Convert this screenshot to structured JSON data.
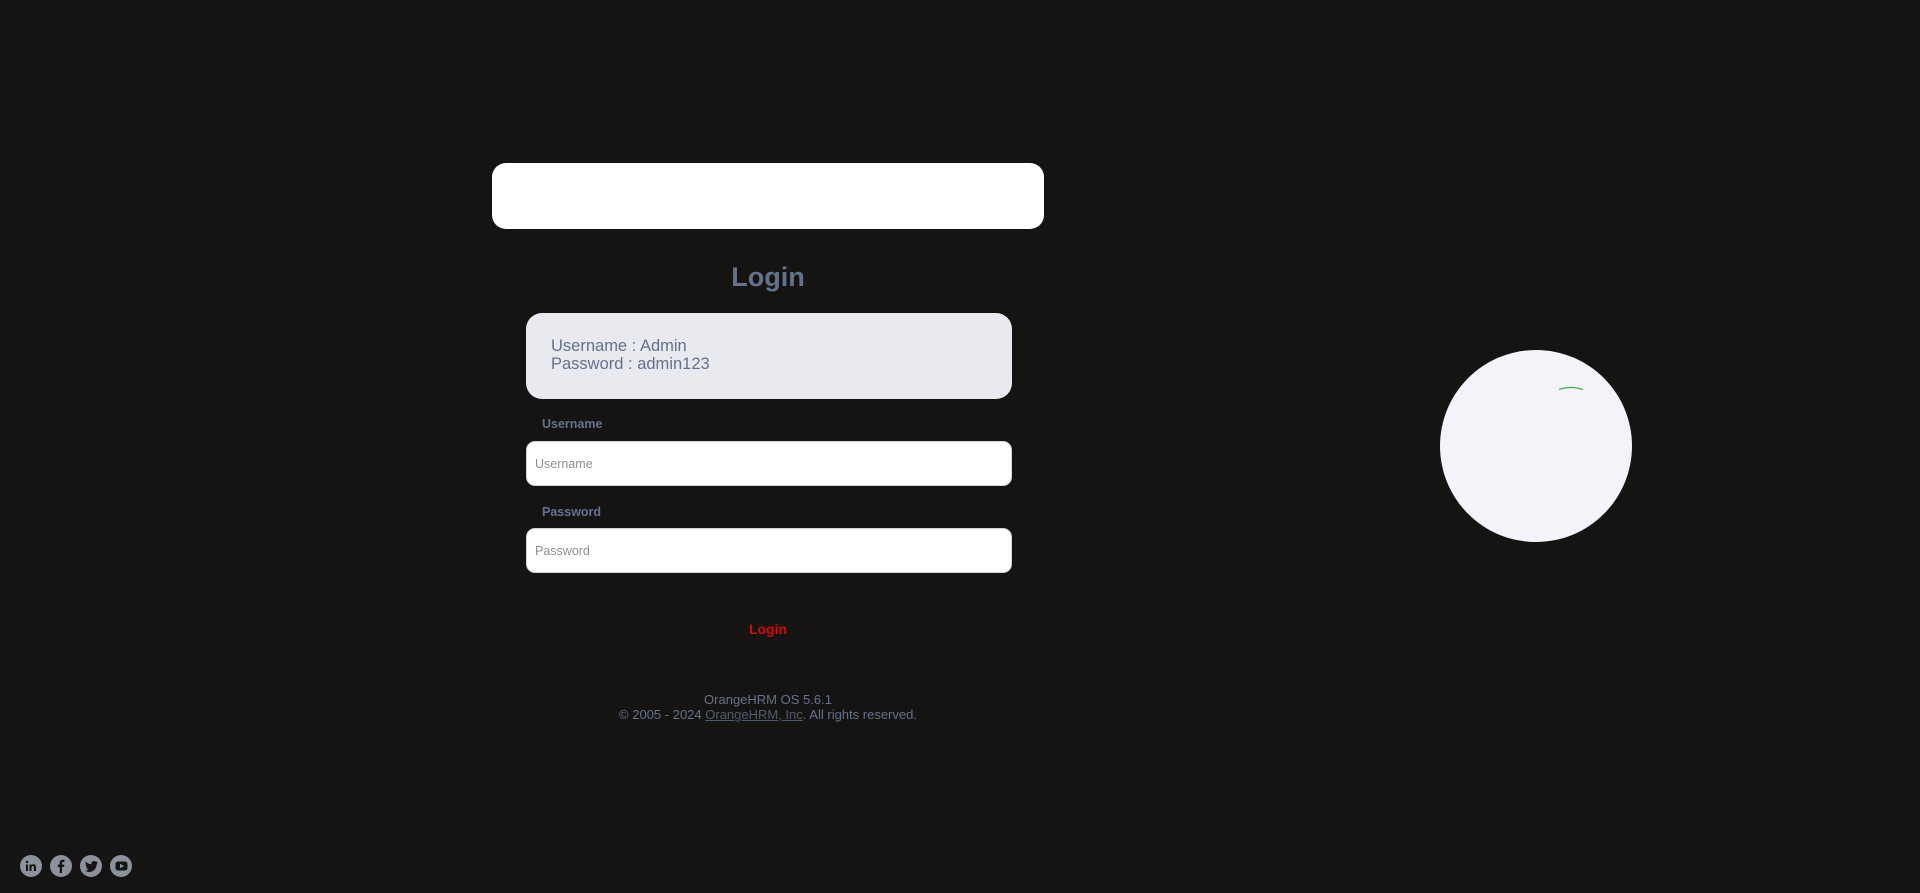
{
  "login": {
    "title": "Login",
    "credentials_line1": "Username : Admin",
    "credentials_line2": "Password : admin123",
    "username_label": "Username",
    "username_placeholder": "Username",
    "password_label": "Password",
    "password_placeholder": "Password",
    "submit_label": "Login"
  },
  "footer": {
    "version": "OrangeHRM OS 5.6.1",
    "copyright_prefix": "© 2005 - 2024 ",
    "company_link": "OrangeHRM, Inc",
    "copyright_suffix": ". All rights reserved."
  },
  "socials": [
    {
      "icon": "linkedin-icon"
    },
    {
      "icon": "facebook-icon"
    },
    {
      "icon": "twitter-icon"
    },
    {
      "icon": "youtube-icon"
    }
  ],
  "colors": {
    "background": "#151412",
    "text_muted": "#64728c",
    "button_text": "#d40a0a",
    "credentials_bg": "#e8eaef",
    "loader_accent": "#3fae49"
  }
}
